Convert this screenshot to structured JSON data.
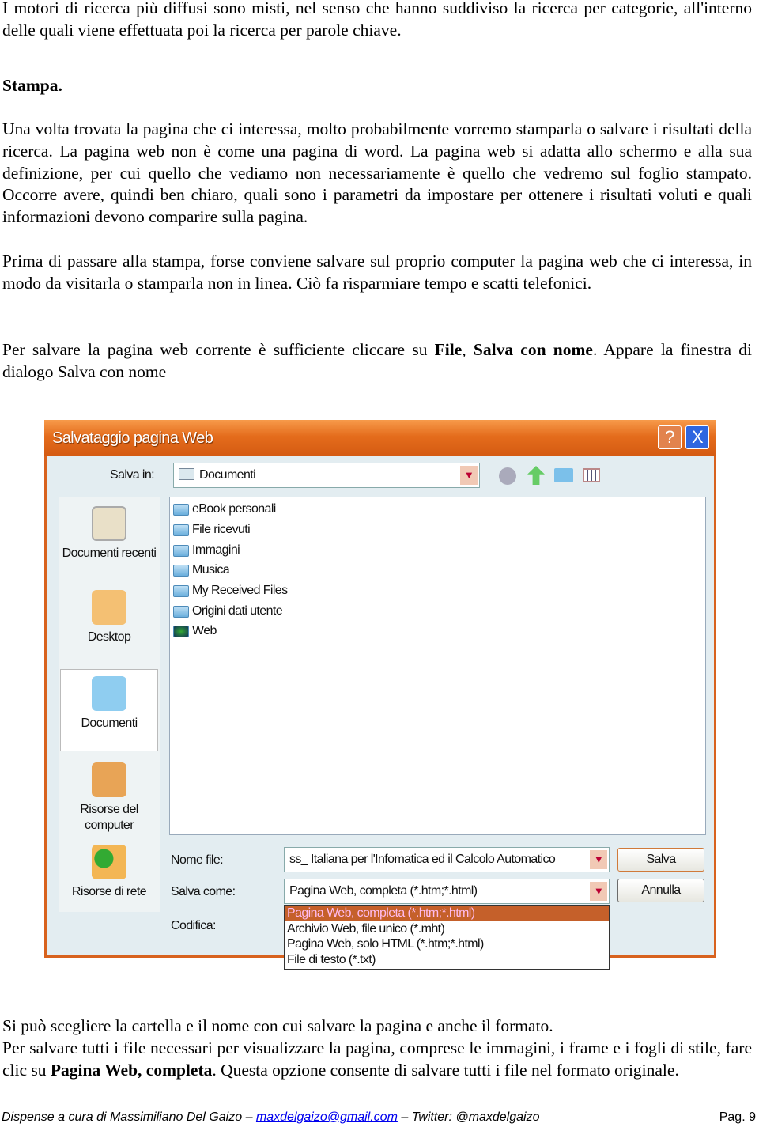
{
  "paragraphs": {
    "p1": "I motori di ricerca più diffusi sono misti, nel senso che hanno suddiviso la ricerca per categorie, all'interno delle quali viene effettuata poi la ricerca per parole chiave.",
    "heading": "Stampa.",
    "p2": "Una volta trovata la pagina che ci interessa, molto probabilmente vorremo stamparla o salvare i risultati della ricerca. La pagina web non è come una pagina di word. La pagina web si adatta allo schermo e alla sua definizione, per cui quello che vediamo non necessariamente è quello che vedremo sul foglio stampato. Occorre avere, quindi ben chiaro, quali sono i parametri da impostare per ottenere i risultati voluti e quali informazioni devono comparire sulla pagina.",
    "p3": "Prima di passare alla stampa, forse conviene salvare sul proprio computer la pagina web che ci interessa, in modo da visitarla o stamparla non in linea. Ciò fa risparmiare tempo e scatti telefonici.",
    "p4a": "Per salvare la pagina web corrente è sufficiente cliccare su ",
    "p4b": "File",
    "p4c": ", ",
    "p4d": "Salva con nome",
    "p4e": ". Appare la finestra di dialogo Salva con nome",
    "p5": "Si può scegliere la cartella e il nome con cui salvare la pagina e anche il formato.",
    "p6a": "Per salvare tutti i file necessari per visualizzare la pagina, comprese le immagini, i frame e i fogli di stile, fare clic su ",
    "p6b": "Pagina Web, completa",
    "p6c": ". Questa opzione consente di salvare tutti i file nel formato originale."
  },
  "dialog": {
    "title": "Salvataggio pagina Web",
    "help": "?",
    "close": "X",
    "save_in_label": "Salva in:",
    "save_in_value": "Documenti",
    "sidebar": [
      "Documenti recenti",
      "Desktop",
      "Documenti",
      "Risorse del computer",
      "Risorse di rete"
    ],
    "files": [
      "eBook personali",
      "File ricevuti",
      "Immagini",
      "Musica",
      "My Received Files",
      "Origini dati utente",
      "Web"
    ],
    "filename_label": "Nome file:",
    "filename_value": "ss_ Italiana per l'Infomatica ed il Calcolo Automatico",
    "saveas_label": "Salva come:",
    "saveas_value": "Pagina Web, completa (*.htm;*.html)",
    "encoding_label": "Codifica:",
    "save_button": "Salva",
    "cancel_button": "Annulla",
    "saveas_options": [
      "Pagina Web, completa (*.htm;*.html)",
      "Archivio Web, file unico (*.mht)",
      "Pagina Web, solo HTML (*.htm;*.html)",
      "File di testo (*.txt)"
    ],
    "title_color": "#e46c1c"
  },
  "footer": {
    "a": "Dispense a cura di Massimiliano Del Gaizo – ",
    "email": "maxdelgaizo@gmail.com",
    "b": " – Twitter: @maxdelgaizo",
    "page": "Pag. 9"
  }
}
